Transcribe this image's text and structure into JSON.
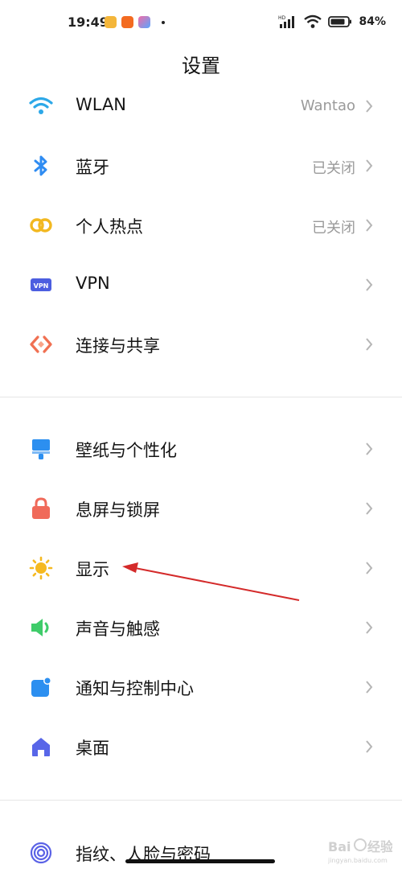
{
  "status_bar": {
    "time": "19:49",
    "battery": "84%",
    "network_label": "HD",
    "icons": [
      "message-notification-icon",
      "mi-app-icon",
      "gallery-app-icon",
      "signal-icon",
      "wifi-icon",
      "battery-icon"
    ]
  },
  "header": {
    "title": "设置"
  },
  "section1": [
    {
      "label": "WLAN",
      "value": "Wantao",
      "icon": "wifi-icon",
      "color": "#2da8e8"
    },
    {
      "label": "蓝牙",
      "value": "已关闭",
      "icon": "bluetooth-icon",
      "color": "#2f8cf2"
    },
    {
      "label": "个人热点",
      "value": "已关闭",
      "icon": "hotspot-icon",
      "color": "#f2b820"
    },
    {
      "label": "VPN",
      "value": "",
      "icon": "vpn-icon",
      "color": "#4c5ee0"
    },
    {
      "label": "连接与共享",
      "value": "",
      "icon": "connection-sharing-icon",
      "color": "#f07052"
    }
  ],
  "section2": [
    {
      "label": "壁纸与个性化",
      "icon": "wallpaper-icon",
      "color": "#2c8ff0"
    },
    {
      "label": "息屏与锁屏",
      "icon": "lock-icon",
      "color": "#f06a5a"
    },
    {
      "label": "显示",
      "icon": "sun-icon",
      "color": "#f5b921"
    },
    {
      "label": "声音与触感",
      "icon": "speaker-icon",
      "color": "#3fcc6a"
    },
    {
      "label": "通知与控制中心",
      "icon": "notification-icon",
      "color": "#2c8ff0"
    },
    {
      "label": "桌面",
      "icon": "home-icon",
      "color": "#5866e8"
    }
  ],
  "section3": [
    {
      "label": "指纹、人脸与密码",
      "icon": "fingerprint-icon",
      "color": "#5a62e6"
    }
  ],
  "watermark": {
    "brand": "Bai",
    "brand_tail": "经验",
    "url": "jingyan.baidu.com"
  },
  "annotation": {
    "color": "#d42a2a"
  }
}
